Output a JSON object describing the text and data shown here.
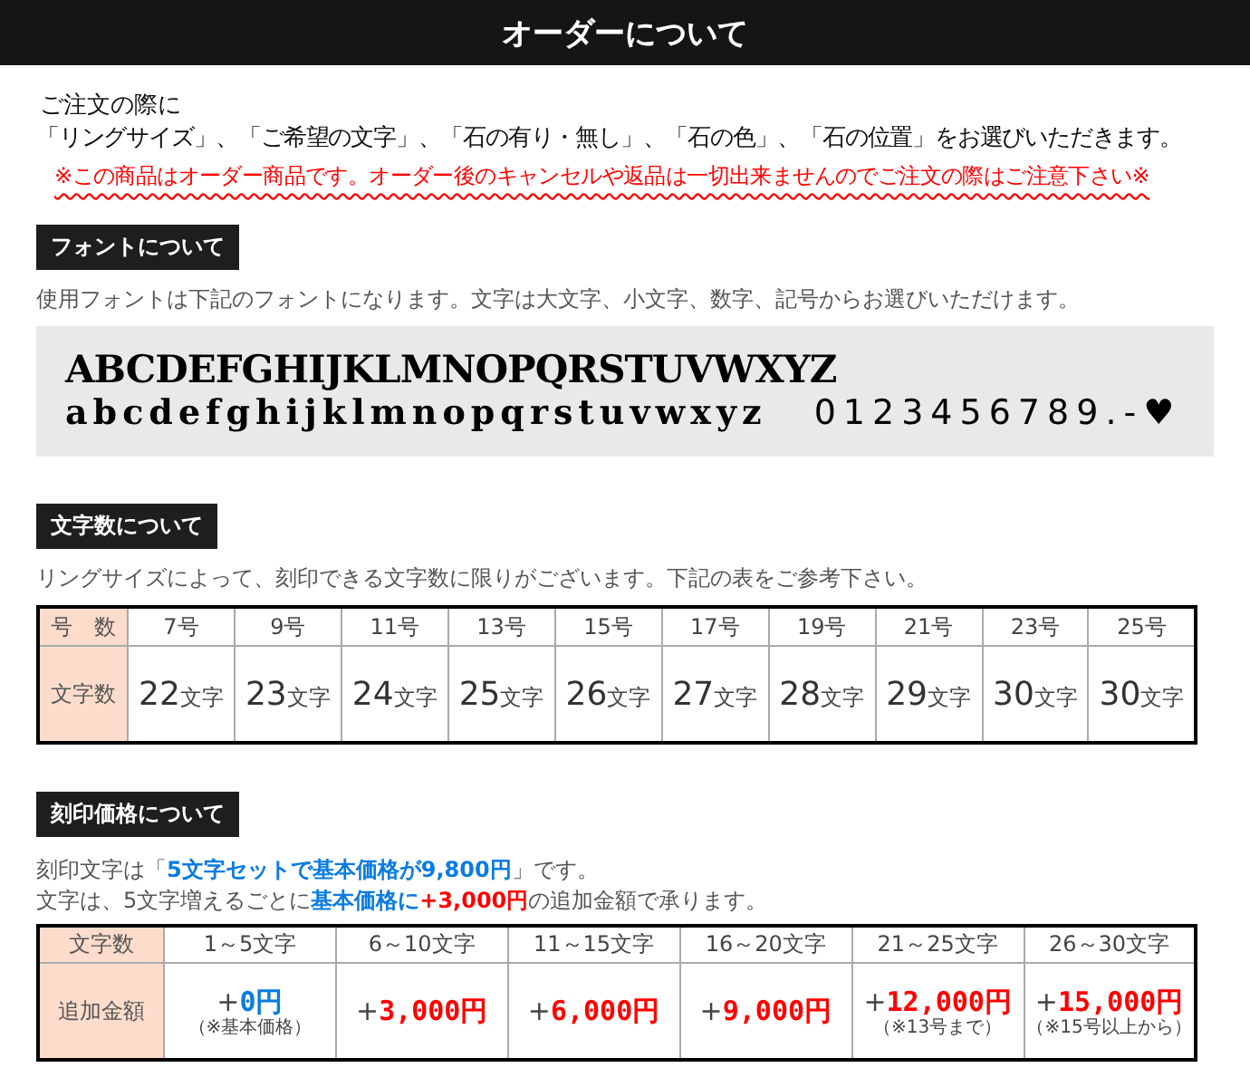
{
  "banner": {
    "title": "オーダーについて"
  },
  "intro": {
    "lead": "ご注文の際に",
    "choices": "「リングサイズ」、「ご希望の文字」、「石の有り・無し」、「石の色」、「石の位置」をお選びいただきます。",
    "notice": "※この商品はオーダー商品です。オーダー後のキャンセルや返品は一切出来ませんのでご注文の際はご注意下さい※"
  },
  "font_section": {
    "heading": "フォントについて",
    "description": "使用フォントは下記のフォントになります。文字は大文字、小文字、数字、記号からお選びいただけます。",
    "uppercase": "ABCDEFGHIJKLMNOPQRSTUVWXYZ",
    "lowercase": "abcdefghijklmnopqrstuvwxyz",
    "digits_symbols": "0123456789.-♥"
  },
  "count_section": {
    "heading": "文字数について",
    "description": "リングサイズによって、刻印できる文字数に限りがございます。下記の表をご参考下さい。",
    "row_header": "号　数",
    "value_header": "文字数",
    "columns": [
      {
        "size": "7号",
        "count": "22",
        "unit": "文字"
      },
      {
        "size": "9号",
        "count": "23",
        "unit": "文字"
      },
      {
        "size": "11号",
        "count": "24",
        "unit": "文字"
      },
      {
        "size": "13号",
        "count": "25",
        "unit": "文字"
      },
      {
        "size": "15号",
        "count": "26",
        "unit": "文字"
      },
      {
        "size": "17号",
        "count": "27",
        "unit": "文字"
      },
      {
        "size": "19号",
        "count": "28",
        "unit": "文字"
      },
      {
        "size": "21号",
        "count": "29",
        "unit": "文字"
      },
      {
        "size": "23号",
        "count": "30",
        "unit": "文字"
      },
      {
        "size": "25号",
        "count": "30",
        "unit": "文字"
      }
    ]
  },
  "price_section": {
    "heading": "刻印価格について",
    "lines": [
      [
        {
          "kind": "plain",
          "text": "刻印文字は「"
        },
        {
          "kind": "blue",
          "text": "5文字セットで基本価格が9,800円"
        },
        {
          "kind": "plain",
          "text": "」です。"
        }
      ],
      [
        {
          "kind": "plain",
          "text": "文字は、5文字増えるごとに"
        },
        {
          "kind": "blue",
          "text": "基本価格に"
        },
        {
          "kind": "red",
          "text": "+3,000円"
        },
        {
          "kind": "plain",
          "text": "の追加金額で承ります。"
        }
      ]
    ],
    "row_header": "文字数",
    "value_header": "追加金額",
    "columns": [
      {
        "range": "1～5文字",
        "sign": "+",
        "amount": "0円",
        "color": "#0a7be0",
        "note": "（※基本価格）"
      },
      {
        "range": "6～10文字",
        "sign": "+",
        "amount": "3,000円",
        "color": "#ff0000"
      },
      {
        "range": "11～15文字",
        "sign": "+",
        "amount": "6,000円",
        "color": "#ff0000"
      },
      {
        "range": "16～20文字",
        "sign": "+",
        "amount": "9,000円",
        "color": "#ff0000"
      },
      {
        "range": "21～25文字",
        "sign": "+",
        "amount": "12,000円",
        "color": "#ff0000",
        "note": "（※13号まで）"
      },
      {
        "range": "26～30文字",
        "sign": "+",
        "amount": "15,000円",
        "color": "#ff0000",
        "note": "（※15号以上から）"
      }
    ]
  }
}
